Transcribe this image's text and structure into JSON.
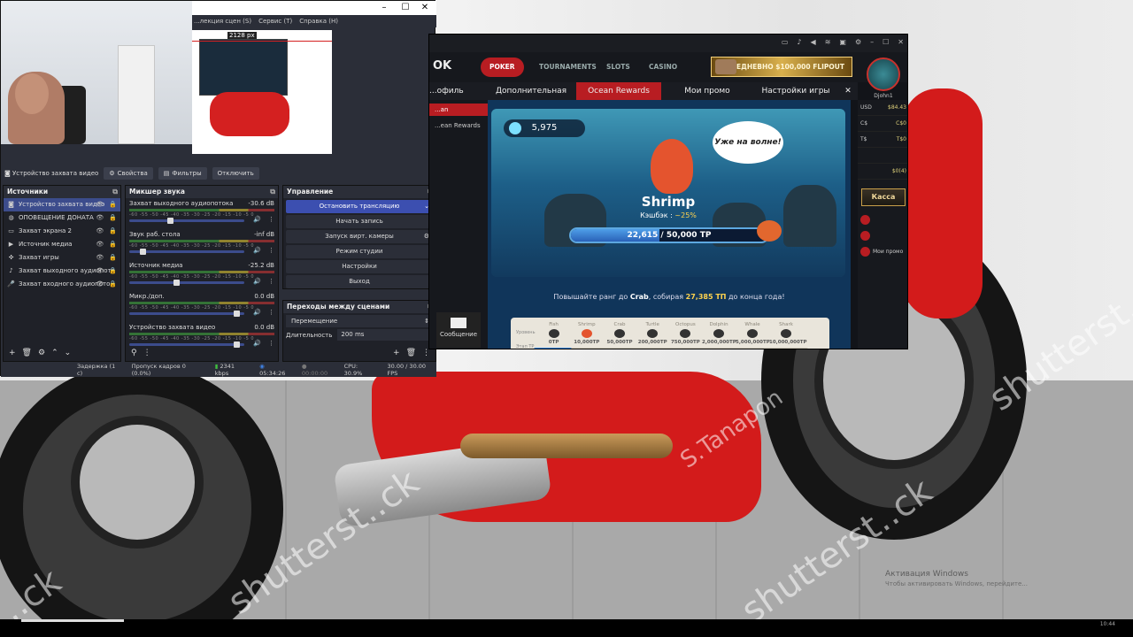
{
  "obs": {
    "menu": [
      "...лекция сцен (S)",
      "Сервис (T)",
      "Справка (H)"
    ],
    "preview_width_label": "2128 px",
    "toolbar": {
      "source_label": "Устройство захвата видео",
      "properties": "Свойства",
      "filters": "Фильтры",
      "disable": "Отключить"
    },
    "sources": {
      "title": "Источники",
      "items": [
        {
          "label": "Устройство захвата видео",
          "icon": "camera-icon",
          "selected": true
        },
        {
          "label": "ОПОВЕЩЕНИЕ ДОНАТА",
          "icon": "globe-icon"
        },
        {
          "label": "Захват экрана 2",
          "icon": "monitor-icon"
        },
        {
          "label": "Источник медиа",
          "icon": "play-icon"
        },
        {
          "label": "Захват игры",
          "icon": "gamepad-icon"
        },
        {
          "label": "Захват выходного аудиопото",
          "icon": "speaker-icon"
        },
        {
          "label": "Захват входного аудиопото",
          "icon": "microphone-icon"
        }
      ]
    },
    "mixer": {
      "title": "Микшер звука",
      "scale": "-60 -55 -50 -45 -40 -35 -30 -25 -20 -15 -10 -5 0",
      "channels": [
        {
          "name": "Захват выходного аудиопотока",
          "db": "-30.6 dB",
          "level": 0.35
        },
        {
          "name": "Звук раб. стола",
          "db": "-inf dB",
          "level": 0.1
        },
        {
          "name": "Источник медиа",
          "db": "-25.2 dB",
          "level": 0.4
        },
        {
          "name": "Микр./доп.",
          "db": "0.0 dB",
          "level": 0.95
        },
        {
          "name": "Устройство захвата видео",
          "db": "0.0 dB",
          "level": 0.95
        }
      ]
    },
    "controls": {
      "title": "Управление",
      "stop_stream": "Остановить трансляцию",
      "start_record": "Начать запись",
      "virtual_cam": "Запуск вирт. камеры",
      "studio_mode": "Режим студии",
      "settings": "Настройки",
      "exit": "Выход"
    },
    "transitions": {
      "title": "Переходы между сценами",
      "type": "Перемещение",
      "duration_label": "Длительность",
      "duration_value": "200 ms"
    },
    "status": {
      "delay": "Задержка (1 с)",
      "dropped": "Пропуск кадров 0 (0.0%)",
      "bitrate": "2341 kbps",
      "live_time": "05:34:26",
      "rec_time": "00:00:00",
      "cpu": "CPU: 30.9%",
      "fps": "30.00 / 30.00 FPS"
    }
  },
  "poker": {
    "logo": "OK",
    "tabs": [
      "POKER",
      "TOURNAMENTS",
      "SLOTS",
      "CASINO"
    ],
    "banner": "ЕЖЕДНЕВНО $100,000 FLIPOUT",
    "username": "Djohn1",
    "subtabs": [
      "...офиль",
      "Дополнительная ставка",
      "Ocean Rewards",
      "Мои промо",
      "Настройки игры"
    ],
    "left_items": [
      "...an",
      "...ean Rewards"
    ],
    "message_label": "Сообщение",
    "gems": "5,975",
    "speech": "Уже на волне!",
    "rank_name": "Shrimp",
    "cashback_label": "Кэшбэк : ",
    "cashback_value": "~25%",
    "tp_progress": "22,615 / 50,000 TP",
    "tp_fraction": 0.452,
    "hint_prefix": "Повышайте ранг до ",
    "hint_rank": "Crab",
    "hint_mid": ", собирая ",
    "hint_amount": "27,385 ТП",
    "hint_suffix": " до конца года!",
    "scroll_side": [
      "Уровень",
      "Этап ТР"
    ],
    "ranks": [
      {
        "name": "Fish",
        "tp": "0TP"
      },
      {
        "name": "Shrimp",
        "tp": "10,000TP"
      },
      {
        "name": "Crab",
        "tp": "50,000TP"
      },
      {
        "name": "Turtle",
        "tp": "200,000TP"
      },
      {
        "name": "Octopus",
        "tp": "750,000TP"
      },
      {
        "name": "Dolphin",
        "tp": "2,000,000TP"
      },
      {
        "name": "Whale",
        "tp": "5,000,000TP"
      },
      {
        "name": "Shark",
        "tp": "10,000,000TP"
      }
    ],
    "balances": [
      {
        "cur": "USD",
        "val": "$84.43"
      },
      {
        "cur": "C$",
        "val": "C$0"
      },
      {
        "cur": "T$",
        "val": "T$0"
      },
      {
        "cur": "",
        "val": ""
      },
      {
        "cur": "",
        "val": "$0(4)"
      }
    ],
    "kassa": "Касса",
    "right_items": [
      "",
      "",
      "Мои промо"
    ]
  },
  "desktop": {
    "watermarks": [
      "shutterst..ck",
      "S.Tanapon",
      "shutterst..ck",
      "shutterst..ck",
      "..ck"
    ],
    "activation_title": "Активация Windows",
    "activation_sub": "Чтобы активировать Windows, перейдите..."
  }
}
